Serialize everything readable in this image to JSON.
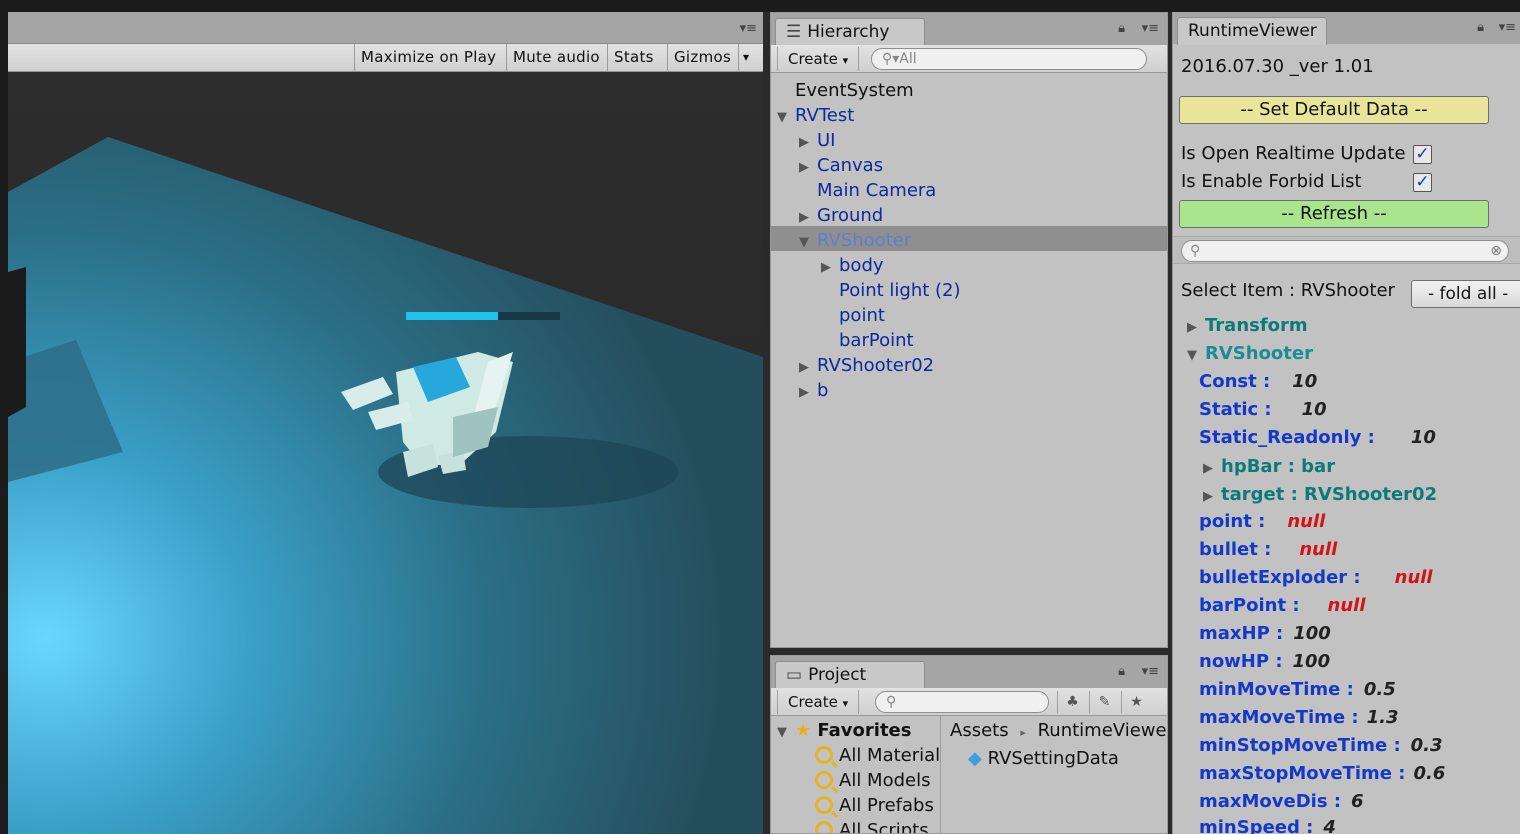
{
  "game_view": {
    "toolbar": [
      {
        "label": "Maximize on Play"
      },
      {
        "label": "Mute audio"
      },
      {
        "label": "Stats"
      },
      {
        "label": "Gizmos"
      }
    ],
    "dropdown_glyph": "▾",
    "hp_fraction": 0.6
  },
  "hierarchy": {
    "tab_label": "Hierarchy",
    "create_label": "Create",
    "search_placeholder": "All",
    "rows": [
      {
        "label": "EventSystem"
      },
      {
        "label": "RVTest"
      },
      {
        "label": "UI"
      },
      {
        "label": "Canvas"
      },
      {
        "label": "Main Camera"
      },
      {
        "label": "Ground"
      },
      {
        "label": "RVShooter"
      },
      {
        "label": "body"
      },
      {
        "label": "Point light (2)"
      },
      {
        "label": "point"
      },
      {
        "label": "barPoint"
      },
      {
        "label": "RVShooter02"
      },
      {
        "label": "b"
      }
    ]
  },
  "project": {
    "tab_label": "Project",
    "create_label": "Create",
    "favorites_label": "Favorites",
    "favorites": [
      "All Material",
      "All Models",
      "All Prefabs",
      "All Scripts"
    ],
    "breadcrumb": [
      "Assets",
      "RuntimeViewer"
    ],
    "assets": [
      "RVSettingData"
    ]
  },
  "runtime_viewer": {
    "tab_label": "RuntimeViewer",
    "version": "2016.07.30 _ver 1.01",
    "set_default_label": "-- Set Default Data --",
    "open_realtime_label": "Is Open Realtime Update",
    "enable_forbid_label": "Is Enable Forbid List",
    "refresh_label": "-- Refresh --",
    "select_item_label": "Select Item : RVShooter",
    "fold_all_label": "- fold all -",
    "transform_label": "Transform",
    "component_label": "RVShooter",
    "fields": [
      {
        "name": "Const :",
        "value": "10"
      },
      {
        "name": "Static :",
        "value": "10"
      },
      {
        "name": "Static_Readonly :",
        "value": "10"
      },
      {
        "name": "hpBar : bar",
        "value": ""
      },
      {
        "name": "target : RVShooter02",
        "value": ""
      },
      {
        "name": "point :",
        "value": "null"
      },
      {
        "name": "bullet :",
        "value": "null"
      },
      {
        "name": "bulletExploder :",
        "value": "null"
      },
      {
        "name": "barPoint :",
        "value": "null"
      },
      {
        "name": "maxHP :",
        "value": "100"
      },
      {
        "name": "nowHP :",
        "value": "100"
      },
      {
        "name": "minMoveTime :",
        "value": "0.5"
      },
      {
        "name": "maxMoveTime :",
        "value": "1.3"
      },
      {
        "name": "minStopMoveTime :",
        "value": "0.3"
      },
      {
        "name": "maxStopMoveTime :",
        "value": "0.6"
      },
      {
        "name": "maxMoveDis :",
        "value": "6"
      },
      {
        "name": "minSpeed :",
        "value": "4"
      }
    ],
    "colors": {
      "set_default_bg": "#e8e59a",
      "refresh_bg": "#a9e58d",
      "null_color": "#d21414",
      "field_color": "#1438c8"
    }
  }
}
